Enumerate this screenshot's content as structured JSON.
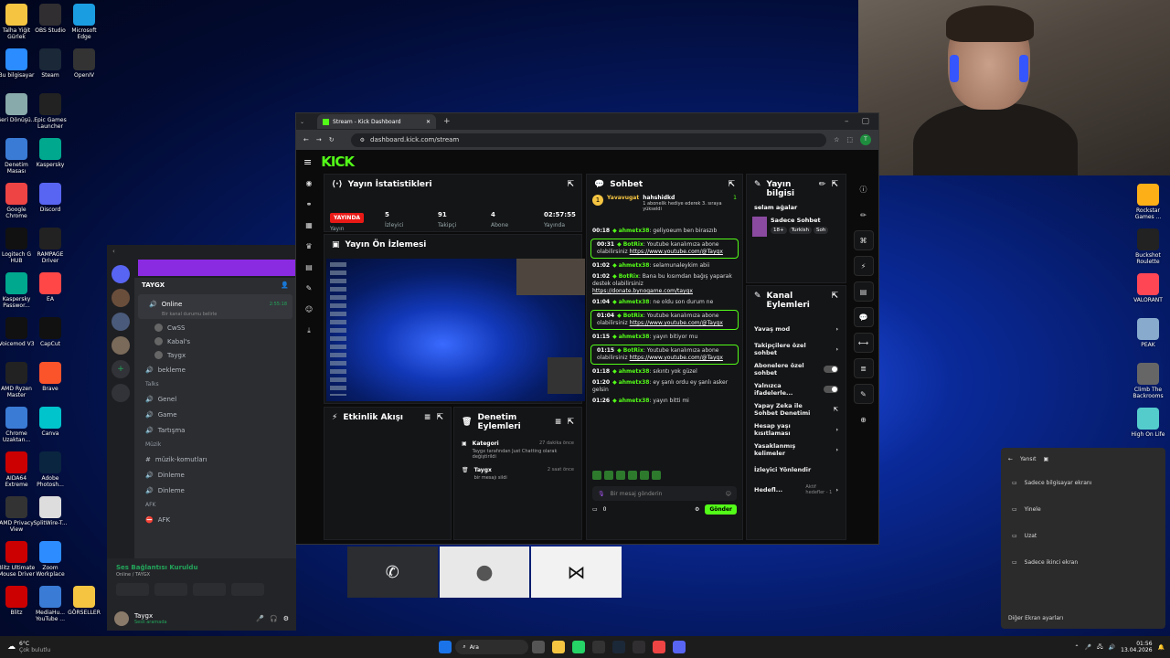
{
  "desktop": {
    "icons_left": [
      {
        "label": "Talha Yiğit Gürlek",
        "icon": "folder-icon",
        "color": "#f5c542"
      },
      {
        "label": "OBS Studio",
        "icon": "obs-icon",
        "color": "#302e31"
      },
      {
        "label": "Microsoft Edge",
        "icon": "edge-icon",
        "color": "#1b9de2"
      },
      {
        "label": "Bu bilgisayar",
        "icon": "monitor-icon",
        "color": "#2a8cff"
      },
      {
        "label": "Steam",
        "icon": "steam-icon",
        "color": "#1b2838"
      },
      {
        "label": "OpenIV",
        "icon": "openiv-icon",
        "color": "#333333"
      },
      {
        "label": "Geri Dönüşü...",
        "icon": "recycle-bin-icon",
        "color": "#8aa"
      },
      {
        "label": "Epic Games Launcher",
        "icon": "epic-icon",
        "color": "#222222"
      },
      {
        "label": "Denetim Masası",
        "icon": "control-panel-icon",
        "color": "#3a7bd5"
      },
      {
        "label": "Kaspersky",
        "icon": "kaspersky-icon",
        "color": "#00a88e"
      },
      {
        "label": "Google Chrome",
        "icon": "chrome-icon",
        "color": "#e44"
      },
      {
        "label": "Discord",
        "icon": "discord-icon",
        "color": "#5865f2"
      },
      {
        "label": "Logitech G HUB",
        "icon": "ghub-icon",
        "color": "#111111"
      },
      {
        "label": "RAMPAGE Driver",
        "icon": "rampage-icon",
        "color": "#222222"
      },
      {
        "label": "Kaspersky Passwor...",
        "icon": "kaspersky-pw-icon",
        "color": "#00a88e"
      },
      {
        "label": "EA",
        "icon": "ea-icon",
        "color": "#ff4747"
      },
      {
        "label": "Voicemod V3",
        "icon": "voicemod-icon",
        "color": "#111111"
      },
      {
        "label": "CapCut",
        "icon": "capcut-icon",
        "color": "#111111"
      },
      {
        "label": "AMD Ryzen Master",
        "icon": "ryzen-icon",
        "color": "#222222"
      },
      {
        "label": "Brave",
        "icon": "brave-icon",
        "color": "#fb542b"
      },
      {
        "label": "Chrome Uzaktan...",
        "icon": "chrome-remote-icon",
        "color": "#3a7bd5"
      },
      {
        "label": "Canva",
        "icon": "canva-icon",
        "color": "#00c4cc"
      },
      {
        "label": "AIDA64 Extreme",
        "icon": "aida-icon",
        "color": "#c00"
      },
      {
        "label": "Adobe Photosh...",
        "icon": "photoshop-icon",
        "color": "#0a2540"
      },
      {
        "label": "AMD Privacy View",
        "icon": "amd-privacy-icon",
        "color": "#333333"
      },
      {
        "label": "SplitWire-T...",
        "icon": "splitwire-icon",
        "color": "#ddd"
      },
      {
        "label": "Blitz Ultimate Mouse Driver",
        "icon": "blitz-mouse-icon",
        "color": "#c00"
      },
      {
        "label": "Zoom Workplace",
        "icon": "zoom-icon",
        "color": "#2d8cff"
      },
      {
        "label": "Blitz",
        "icon": "blitz-icon",
        "color": "#c00"
      },
      {
        "label": "MediaHu... YouTube ...",
        "icon": "mediahuman-icon",
        "color": "#3a7bd5"
      },
      {
        "label": "GÖRSELLER",
        "icon": "folder-icon",
        "color": "#f5c542"
      }
    ],
    "icons_right": [
      {
        "label": "Rockstar Games ...",
        "icon": "rockstar-icon",
        "color": "#fcaf17"
      },
      {
        "label": "Buckshot Roulette",
        "icon": "buckshot-icon",
        "color": "#222222"
      },
      {
        "label": "VALORANT",
        "icon": "valorant-icon",
        "color": "#ff4655"
      },
      {
        "label": "PEAK",
        "icon": "peak-icon",
        "color": "#88aacc"
      },
      {
        "label": "Climb The Backrooms",
        "icon": "backrooms-icon",
        "color": "#666666"
      },
      {
        "label": "High On Life",
        "icon": "highonlife-icon",
        "color": "#5cc"
      }
    ]
  },
  "browser": {
    "tab_title": "Stream - Kick Dashboard",
    "url": "dashboard.kick.com/stream",
    "profile_initial": "T"
  },
  "kick": {
    "logo": "KICK",
    "stats": {
      "title": "Yayın İstatistikleri",
      "live_badge": "YAYINDA",
      "items": [
        {
          "value": "",
          "label": "Yayın"
        },
        {
          "value": "5",
          "label": "İzleyici"
        },
        {
          "value": "91",
          "label": "Takipçi"
        },
        {
          "value": "4",
          "label": "Abone"
        },
        {
          "value": "02:57:55",
          "label": "Yayında"
        }
      ]
    },
    "preview_title": "Yayın Ön İzlemesi",
    "activity_title": "Etkinlik Akışı",
    "mod_title": "Denetim Eylemleri",
    "mod_items": [
      {
        "user": "Kategori",
        "time": "27 dakika önce",
        "text": "Taygx tarafından Just Chatting olarak değiştirildi"
      },
      {
        "user": "Taygx",
        "time": "2 saat önce",
        "text": "bir mesajı sildi"
      }
    ],
    "chat": {
      "title": "Sohbet",
      "pinned_user": "Yavavugat",
      "pinned_gift_user": "hahshidkd",
      "pinned_gift_text": "1 abonelik hediye ederek 3. sıraya yükseldi",
      "pinned_count": "1",
      "messages": [
        {
          "time": "00:18",
          "user": "ahmetx38",
          "text": "geliyoeum ben biraszıb",
          "bot": false,
          "link": ""
        },
        {
          "time": "00:31",
          "user": "BotRix",
          "text": "Youtube kanalımıza abone olabilirsiniz",
          "bot": true,
          "link": "https://www.youtube.com/@Taygx"
        },
        {
          "time": "01:02",
          "user": "ahmetx38",
          "text": "selamunaleykim abii",
          "bot": false,
          "link": ""
        },
        {
          "time": "01:02",
          "user": "BotRix",
          "text": "Bana bu kısımdan bağış yaparak destek olabilirsiniz",
          "bot": false,
          "link": "https://donate.bynogame.com/taygx"
        },
        {
          "time": "01:04",
          "user": "ahmetx38",
          "text": "ne oldu son durum ne",
          "bot": false,
          "link": ""
        },
        {
          "time": "01:04",
          "user": "BotRix",
          "text": "Youtube kanalımıza abone olabilirsiniz",
          "bot": true,
          "link": "https://www.youtube.com/@Taygx"
        },
        {
          "time": "01:15",
          "user": "ahmetx38",
          "text": "yayın bitiyor mu",
          "bot": false,
          "link": ""
        },
        {
          "time": "01:15",
          "user": "BotRix",
          "text": "Youtube kanalımıza abone olabilirsiniz",
          "bot": true,
          "link": "https://www.youtube.com/@Taygx"
        },
        {
          "time": "01:18",
          "user": "ahmetx38",
          "text": "sıkıntı yok güzel",
          "bot": false,
          "link": ""
        },
        {
          "time": "01:20",
          "user": "ahmetx38",
          "text": "ey şanlı ordu ey şanlı asker gelsin",
          "bot": false,
          "link": ""
        },
        {
          "time": "01:26",
          "user": "ahmetx38",
          "text": "yayın bitti mi",
          "bot": false,
          "link": ""
        }
      ],
      "input_placeholder": "Bir mesaj gönderin",
      "send_label": "Gönder",
      "counter": "0"
    },
    "info": {
      "title": "Yayın bilgisi",
      "stream_title": "selam ağalar",
      "category": "Sadece Sohbet",
      "tags": [
        "18+",
        "Turkish",
        "Soh"
      ]
    },
    "channel_actions": {
      "title": "Kanal Eylemleri",
      "items": [
        {
          "label": "Yavaş mod",
          "kind": "arrow"
        },
        {
          "label": "Takipçilere özel sohbet",
          "kind": "arrow"
        },
        {
          "label": "Abonelere özel sohbet",
          "kind": "toggle"
        },
        {
          "label": "Yalnızca ifadelerle...",
          "kind": "toggle"
        },
        {
          "label": "Yapay Zeka ile Sohbet Denetimi",
          "kind": "link"
        },
        {
          "label": "Hesap yaşı kısıtlaması",
          "kind": "arrow"
        },
        {
          "label": "Yasaklanmış kelimeler",
          "kind": "arrow"
        },
        {
          "label": "İzleyici Yönlendir",
          "kind": "none"
        },
        {
          "label": "Hedefl...",
          "kind": "goal"
        }
      ],
      "goal_text": "Aktif hedefler - 1"
    }
  },
  "discord": {
    "server": "TAYGX",
    "voice_channel": "Online",
    "voice_status": "Bir kanal durumu belirle",
    "voice_time": "2:55:18",
    "voice_users": [
      "CwSS",
      "Kabal's",
      "Taygx"
    ],
    "channel_bekleme": "bekleme",
    "cat_talks": "Talks",
    "talks": [
      "Genel",
      "Game",
      "Tartışma"
    ],
    "cat_music": "Müzik",
    "music": [
      "müzik-komutları",
      "Dinleme",
      "Dinleme"
    ],
    "cat_afk": "AFK",
    "afk": [
      "AFK"
    ],
    "conn_title": "Ses Bağlantısı Kuruldu",
    "conn_sub": "Online / TAYGX",
    "user_name": "Taygx",
    "user_status": "Sesli aramada"
  },
  "share": {
    "header": "Yansıt",
    "items": [
      "Sadece bilgisayar ekranı",
      "Yinele",
      "Uzat",
      "Sadece ikinci ekran"
    ],
    "footer": "Diğer Ekran ayarları"
  },
  "taskbar": {
    "weather_temp": "6°C",
    "weather_text": "Çok bulutlu",
    "search": "Ara",
    "time": "01:56",
    "date": "13.04.2026"
  }
}
